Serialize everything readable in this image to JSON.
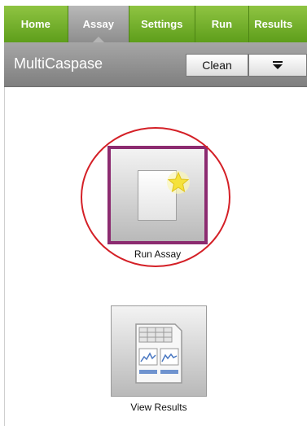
{
  "tabs": [
    {
      "label": "Home",
      "active": false
    },
    {
      "label": "Assay",
      "active": true
    },
    {
      "label": "Settings",
      "active": false
    },
    {
      "label": "Run",
      "active": false
    },
    {
      "label": "Results",
      "active": false
    }
  ],
  "toolbar": {
    "title": "MultiCaspase",
    "clean_label": "Clean",
    "menu_icon": "menu-dropdown-icon"
  },
  "tiles": {
    "run_assay": {
      "label": "Run Assay",
      "icon": "new-document-star-icon"
    },
    "view_results": {
      "label": "View Results",
      "icon": "results-sheet-icon"
    }
  },
  "colors": {
    "tab_green": "#6aa82a",
    "tab_active_gray": "#a3a3a3",
    "toolbar_gray": "#8f8f8f",
    "highlight_purple": "#8c2b70",
    "annotation_red": "#d42027",
    "star_yellow": "#f5e23a"
  }
}
